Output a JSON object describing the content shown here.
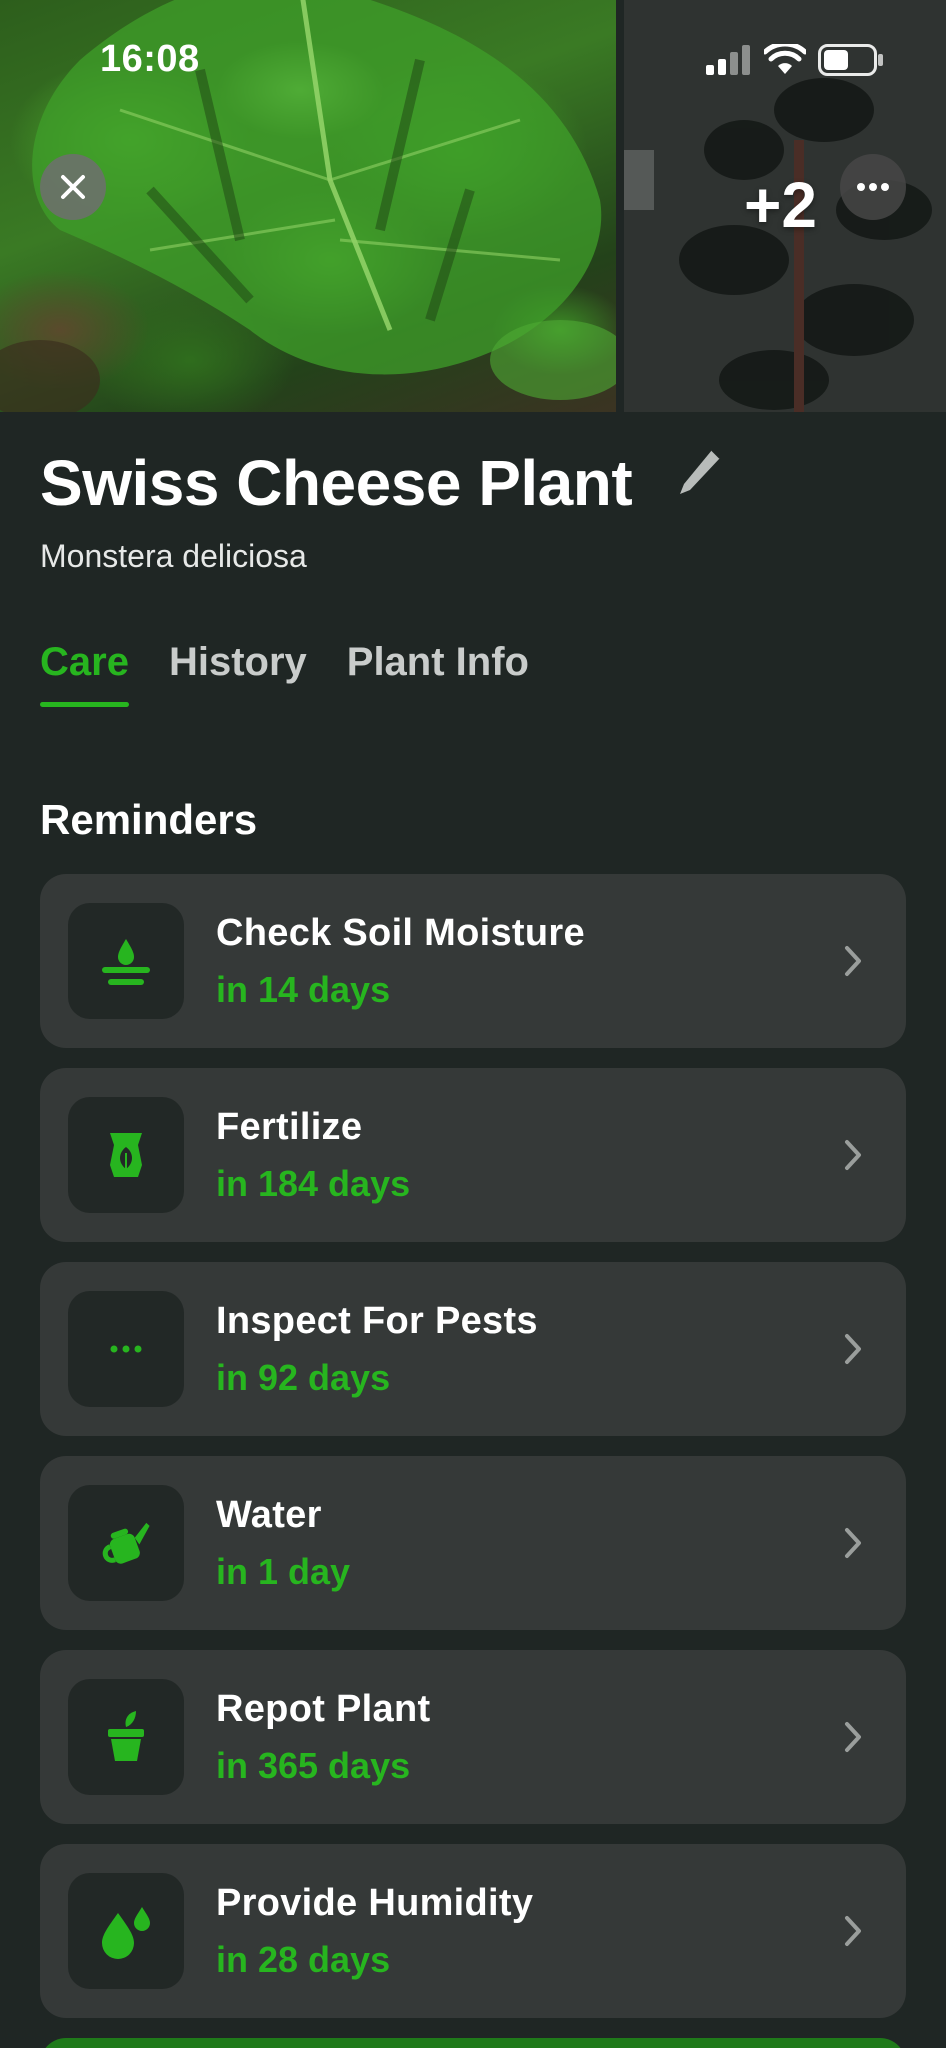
{
  "status_bar": {
    "time": "16:08"
  },
  "gallery": {
    "more_count": "+2"
  },
  "plant": {
    "name": "Swiss Cheese Plant",
    "scientific_name": "Monstera deliciosa"
  },
  "tabs": [
    {
      "label": "Care",
      "active": true
    },
    {
      "label": "History",
      "active": false
    },
    {
      "label": "Plant Info",
      "active": false
    }
  ],
  "reminders": {
    "title": "Reminders",
    "items": [
      {
        "title": "Check Soil Moisture",
        "due": "in 14 days",
        "icon": "soil-moisture-icon"
      },
      {
        "title": "Fertilize",
        "due": "in 184 days",
        "icon": "fertilizer-bag-icon"
      },
      {
        "title": "Inspect For Pests",
        "due": "in 92 days",
        "icon": "ellipsis-icon"
      },
      {
        "title": "Water",
        "due": "in 1 day",
        "icon": "watering-can-icon"
      },
      {
        "title": "Repot Plant",
        "due": "in 365 days",
        "icon": "pot-icon"
      },
      {
        "title": "Provide Humidity",
        "due": "in 28 days",
        "icon": "droplets-icon"
      }
    ]
  },
  "colors": {
    "accent": "#27b51f",
    "background": "#1f2624",
    "card": "#353938",
    "icon_box": "#222826"
  }
}
